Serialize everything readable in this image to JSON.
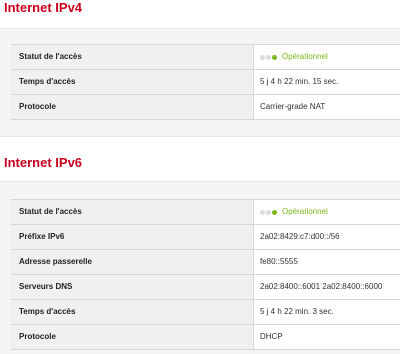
{
  "colors": {
    "title": "#c8001e",
    "status_ok": "#7cb518",
    "dot_inactive": "#dcdcdc"
  },
  "ipv4": {
    "title": "Internet IPv4",
    "rows": [
      {
        "label": "Statut de l'accès",
        "value": "Opérationnel"
      },
      {
        "label": "Temps d'accès",
        "value": "5 j 4 h 22 min. 15 sec."
      },
      {
        "label": "Protocole",
        "value": "Carrier-grade NAT"
      }
    ]
  },
  "ipv6": {
    "title": "Internet IPv6",
    "rows": [
      {
        "label": "Statut de l'accès",
        "value": "Opérationnel"
      },
      {
        "label": "Préfixe IPv6",
        "value": "2a02:8429:c7:d00::/56"
      },
      {
        "label": "Adresse passerelle",
        "value": "fe80::5555"
      },
      {
        "label": "Serveurs DNS",
        "value": "2a02:8400::6001 2a02:8400::6000"
      },
      {
        "label": "Temps d'accès",
        "value": "5 j 4 h 22 min. 3 sec."
      },
      {
        "label": "Protocole",
        "value": "DHCP"
      }
    ]
  }
}
